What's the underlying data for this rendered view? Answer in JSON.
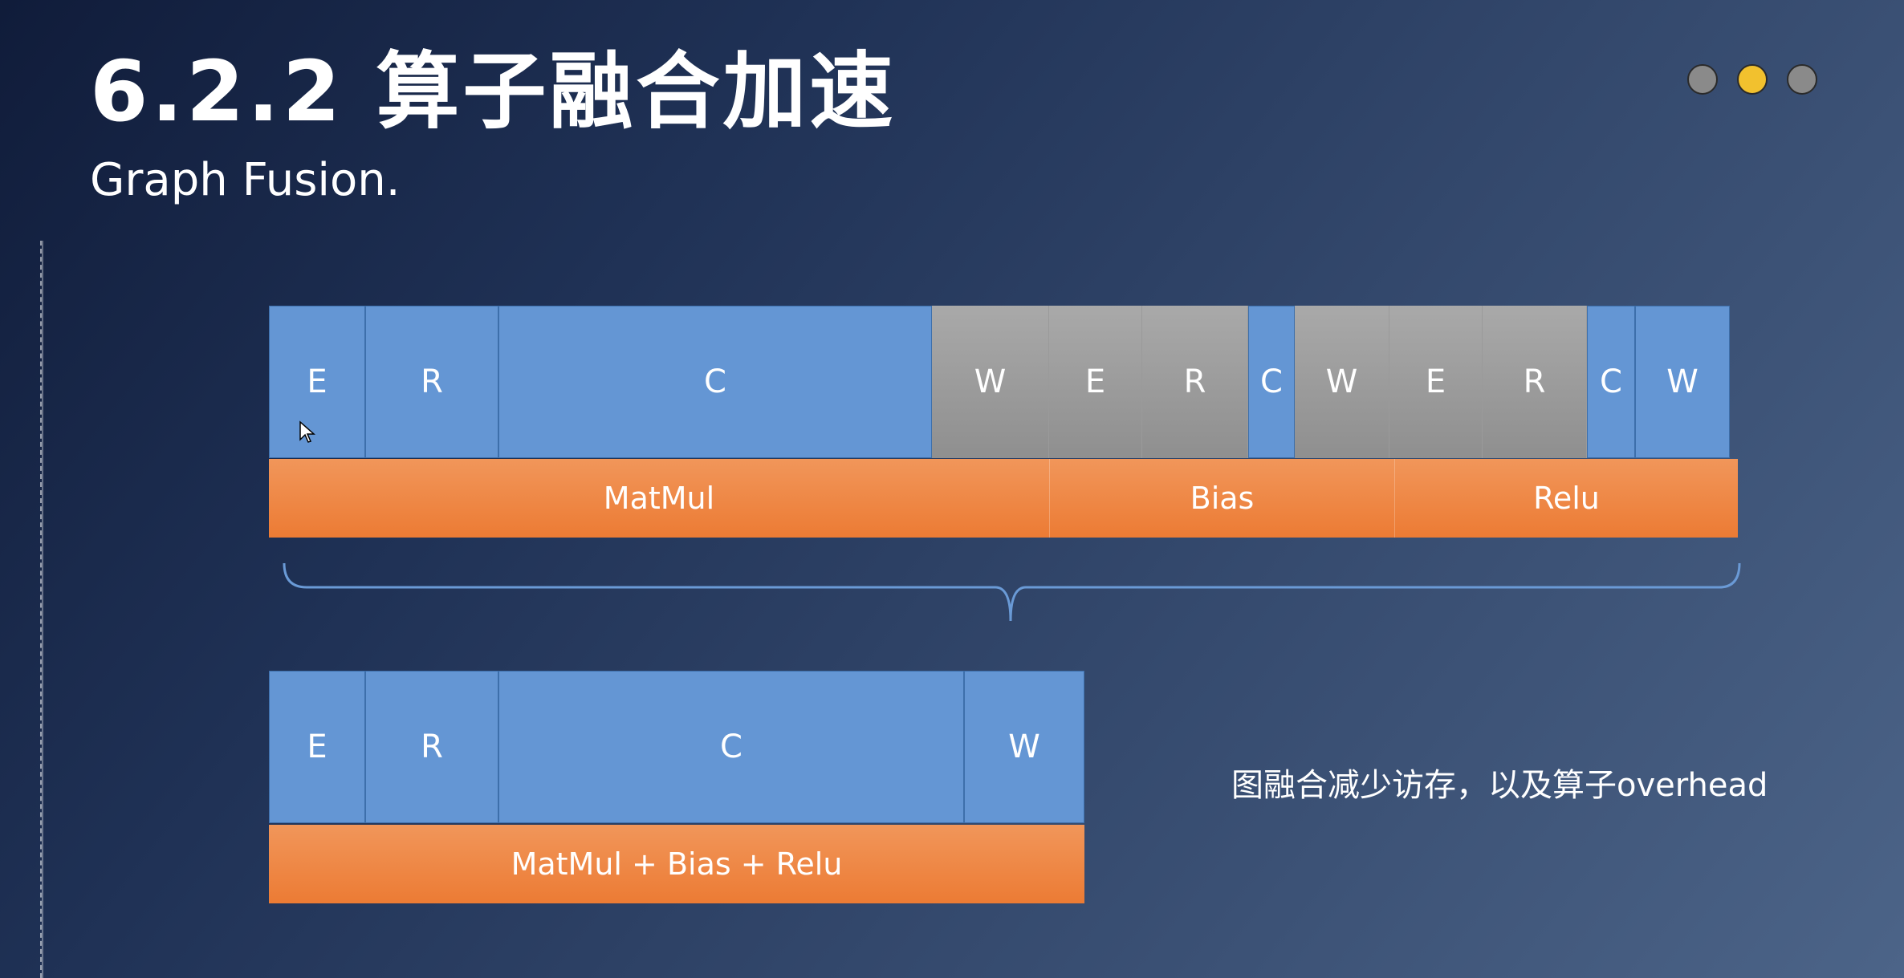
{
  "header": {
    "title": "6.2.2  算子融合加速",
    "subtitle": "Graph Fusion.",
    "slide_dots": [
      {
        "color": "#8a8a8a",
        "active": false
      },
      {
        "color": "#f2c12e",
        "active": true
      },
      {
        "color": "#8a8a8a",
        "active": false
      }
    ]
  },
  "colors": {
    "blue_block": "#6496d4",
    "gray_block": "#9a9a9a",
    "orange_bar": "#ec7b34",
    "brace": "#6a9ad6"
  },
  "top_diagram": {
    "stages": [
      {
        "label": "E",
        "kind": "blue"
      },
      {
        "label": "R",
        "kind": "blue"
      },
      {
        "label": "C",
        "kind": "blue"
      },
      {
        "label": "W",
        "kind": "gray"
      },
      {
        "label": "E",
        "kind": "gray"
      },
      {
        "label": "R",
        "kind": "gray"
      },
      {
        "label": "C",
        "kind": "blue"
      },
      {
        "label": "W",
        "kind": "gray"
      },
      {
        "label": "E",
        "kind": "gray"
      },
      {
        "label": "R",
        "kind": "gray"
      },
      {
        "label": "C",
        "kind": "blue"
      },
      {
        "label": "W",
        "kind": "blue"
      }
    ],
    "ops": [
      "MatMul",
      "Bias",
      "Relu"
    ]
  },
  "bottom_diagram": {
    "stages": [
      {
        "label": "E",
        "kind": "blue"
      },
      {
        "label": "R",
        "kind": "blue"
      },
      {
        "label": "C",
        "kind": "blue"
      },
      {
        "label": "W",
        "kind": "blue"
      }
    ],
    "ops": [
      "MatMul + Bias + Relu"
    ]
  },
  "caption": "图融合减少访存，以及算子overhead"
}
